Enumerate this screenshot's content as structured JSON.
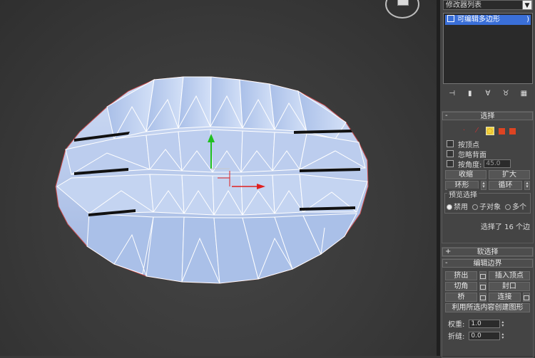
{
  "modifier_list": {
    "dropdown_label": "修改器列表",
    "stack_item": "可编辑多边形"
  },
  "rollouts": {
    "selection": {
      "title": "选择",
      "by_vertex": "按顶点",
      "ignore_backfacing": "忽略背面",
      "by_angle": "按角度:",
      "angle_value": "45.0",
      "shrink": "收缩",
      "grow": "扩大",
      "ring": "环形",
      "loop": "循环",
      "preview_title": "预览选择",
      "preview_options": [
        "禁用",
        "子对象",
        "多个"
      ],
      "status": "选择了 16 个边"
    },
    "soft_selection": {
      "title": "软选择"
    },
    "edit_edges": {
      "title": "编辑边界",
      "extrude": "挤出",
      "insert_vertex": "插入顶点",
      "chamfer": "切角",
      "cap": "封口",
      "bridge": "桥",
      "connect": "连接",
      "create_shape": "利用所选内容创建图形",
      "weight_label": "权重:",
      "weight_value": "1.0",
      "crease_label": "折缝:",
      "crease_value": "0.0"
    }
  },
  "colors": {
    "mesh_face": "#b7cbed",
    "mesh_edge": "#ffffff",
    "selected_edge": "#e8403a",
    "axis_x": "#e02020",
    "axis_y": "#20c020",
    "stack_highlight": "#3a6fd8",
    "active_level": "#f4d63b"
  },
  "icons": [
    "pin-stack-icon",
    "show-end-result-icon",
    "make-unique-icon",
    "remove-modifier-icon",
    "configure-sets-icon"
  ]
}
